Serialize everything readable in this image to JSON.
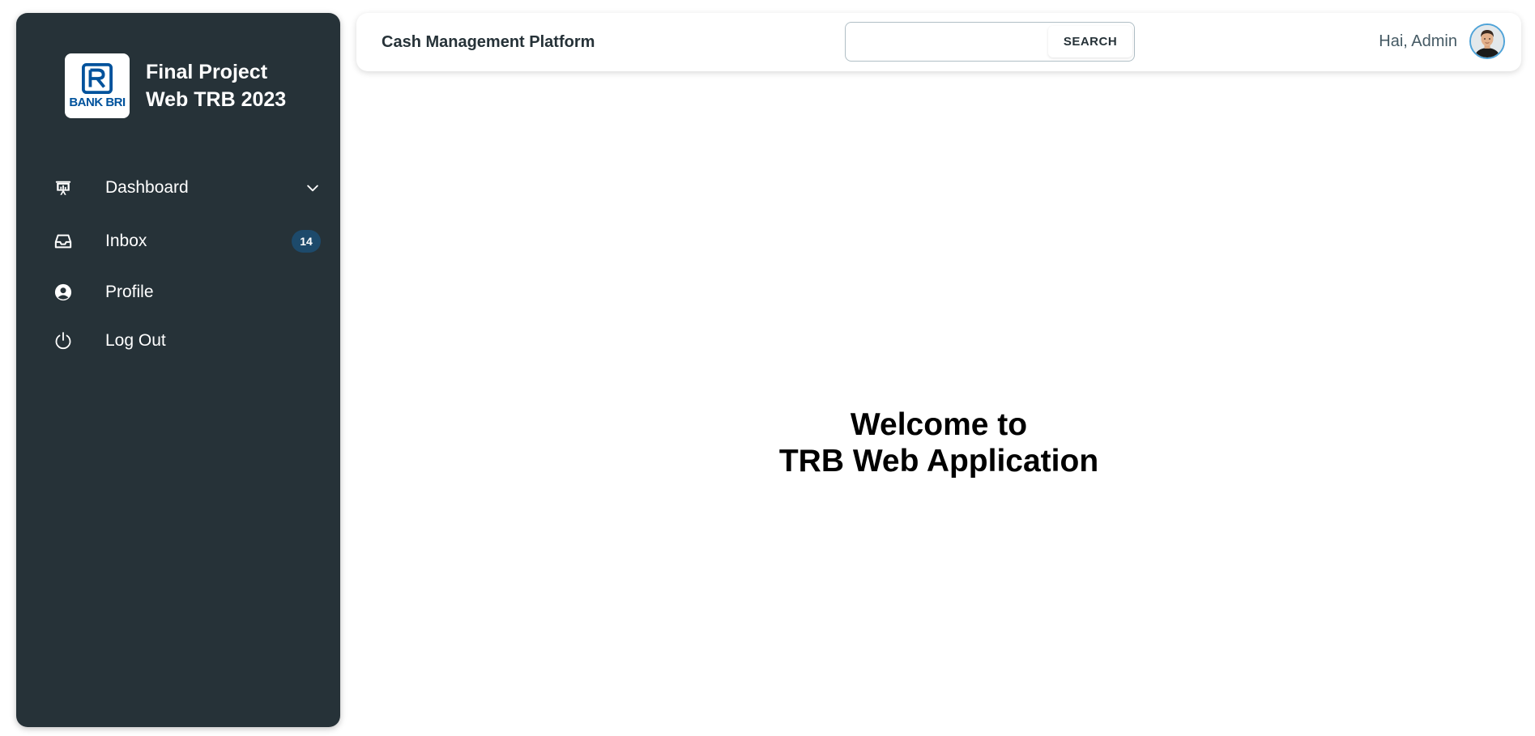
{
  "sidebar": {
    "logo_text": "BANK BRI",
    "brand_line1": "Final Project",
    "brand_line2": "Web TRB 2023",
    "items": [
      {
        "label": "Dashboard",
        "icon": "presentation-chart-icon",
        "has_chevron": true
      },
      {
        "label": "Inbox",
        "icon": "inbox-icon",
        "badge": "14"
      },
      {
        "label": "Profile",
        "icon": "user-circle-icon"
      },
      {
        "label": "Log Out",
        "icon": "power-icon"
      }
    ]
  },
  "header": {
    "title": "Cash Management Platform",
    "search": {
      "value": "",
      "placeholder": "",
      "button_label": "SEARCH"
    },
    "greeting": "Hai, Admin"
  },
  "main": {
    "welcome_line1": "Welcome to",
    "welcome_line2": "TRB Web Application"
  },
  "colors": {
    "sidebar_bg": "#263238",
    "badge_bg": "#1d4a6b",
    "brand_blue": "#00529c",
    "avatar_ring": "#4fa3d8"
  }
}
